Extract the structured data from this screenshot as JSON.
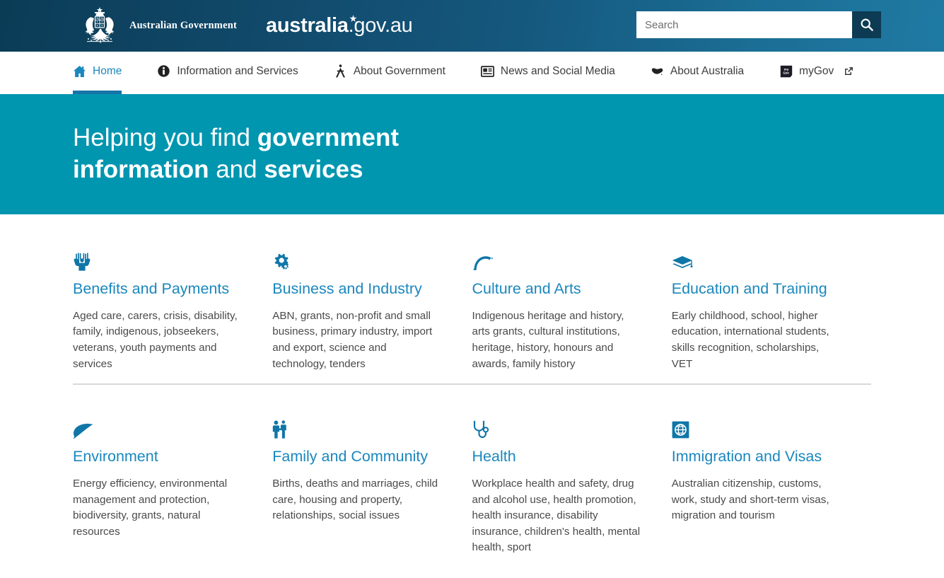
{
  "header": {
    "crest_icon": "australian-coat-of-arms",
    "government_text": "Australian Government",
    "wordmark_bold": "australia",
    "wordmark_light": ".gov.au",
    "search": {
      "placeholder": "Search",
      "value": "",
      "button_icon": "search-icon"
    },
    "colors": {
      "gradient_start": "#0b3c56",
      "gradient_end": "#1f7aa3",
      "search_button_bg": "#0d3b53"
    }
  },
  "nav": {
    "items": [
      {
        "label": "Home",
        "icon": "home-icon",
        "active": true,
        "external": false
      },
      {
        "label": "Information and Services",
        "icon": "info-circle-icon",
        "active": false,
        "external": false
      },
      {
        "label": "About Government",
        "icon": "person-icon",
        "active": false,
        "external": false
      },
      {
        "label": "News and Social Media",
        "icon": "newspaper-icon",
        "active": false,
        "external": false
      },
      {
        "label": "About Australia",
        "icon": "australia-map-icon",
        "active": false,
        "external": false
      },
      {
        "label": "myGov",
        "icon": "mygov-icon",
        "active": false,
        "external": true
      }
    ],
    "active_underline_color": "#1674a8",
    "active_text_color": "#1a87bd"
  },
  "hero": {
    "line1_light": "Helping you find ",
    "line1_bold": "government",
    "line2_bold_a": "information",
    "line2_light": " and ",
    "line2_bold_b": "services",
    "background_color": "#0096b0"
  },
  "cards": {
    "title_color": "#1a87bd",
    "row1": [
      {
        "icon": "raised-hands-icon",
        "title": "Benefits and Payments",
        "desc": "Aged care, carers, crisis, disability, family, indigenous, jobseekers, veterans, youth payments and services"
      },
      {
        "icon": "gears-icon",
        "title": "Business and Industry",
        "desc": "ABN, grants, non-profit and small business, primary industry, import and export, science and technology, tenders"
      },
      {
        "icon": "boomerang-icon",
        "title": "Culture and Arts",
        "desc": "Indigenous heritage and history, arts grants, cultural institutions, heritage, history, honours and awards, family history"
      },
      {
        "icon": "graduation-cap-icon",
        "title": "Education and Training",
        "desc": "Early childhood, school, higher education, international students, skills recognition, scholarships, VET"
      }
    ],
    "row2": [
      {
        "icon": "leaf-icon",
        "title": "Environment",
        "desc": "Energy efficiency, environmental management and protection, biodiversity, grants, natural resources"
      },
      {
        "icon": "family-icon",
        "title": "Family and Community",
        "desc": "Births, deaths and marriages, child care, housing and property, relationships, social issues"
      },
      {
        "icon": "stethoscope-icon",
        "title": "Health",
        "desc": "Workplace health and safety, drug and alcohol use, health promotion, health insurance, disability insurance, children's health, mental health, sport"
      },
      {
        "icon": "passport-globe-icon",
        "title": "Immigration and Visas",
        "desc": "Australian citizenship, customs, work, study and short-term visas, migration and tourism"
      }
    ]
  }
}
